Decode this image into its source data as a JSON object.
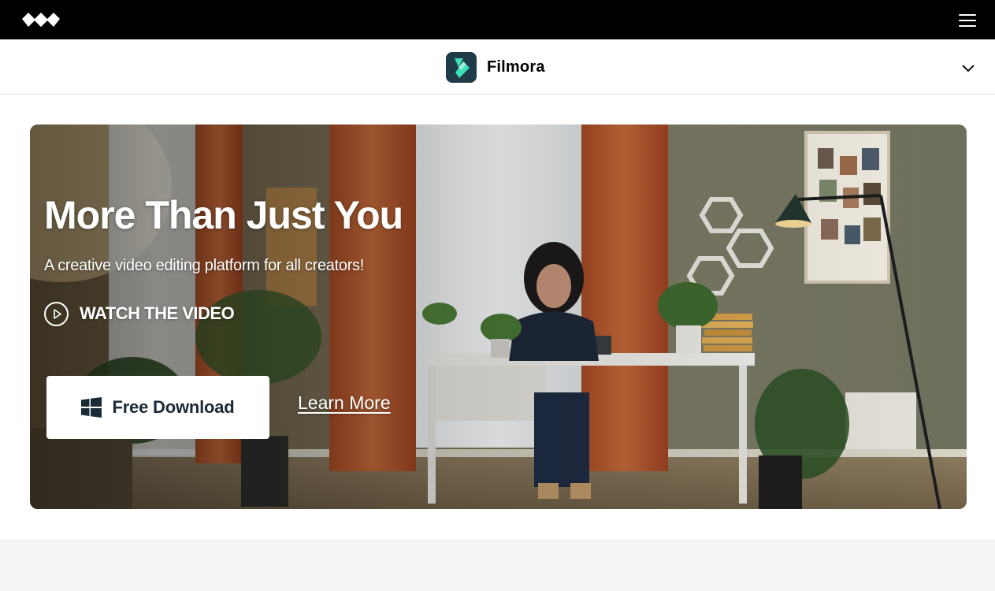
{
  "topbar": {
    "logo_icon": "wondershare-logo-icon",
    "menu_icon": "hamburger-menu-icon"
  },
  "productbar": {
    "product_icon": "filmora-logo-icon",
    "product_name": "Filmora",
    "dropdown_icon": "chevron-down-icon"
  },
  "hero": {
    "title": "More Than Just You",
    "subtitle": "A creative video editing platform for all creators!",
    "watch_label": "WATCH THE VIDEO",
    "watch_icon": "play-circle-icon",
    "download_label": "Free Download",
    "download_icon": "windows-icon",
    "learn_more_label": "Learn More"
  },
  "colors": {
    "topbar_bg": "#000000",
    "product_icon_bg": "#1f3b47",
    "product_icon_accent": "#3de0b8",
    "download_text": "#1a2b36",
    "bottom_band": "#f5f5f5"
  }
}
